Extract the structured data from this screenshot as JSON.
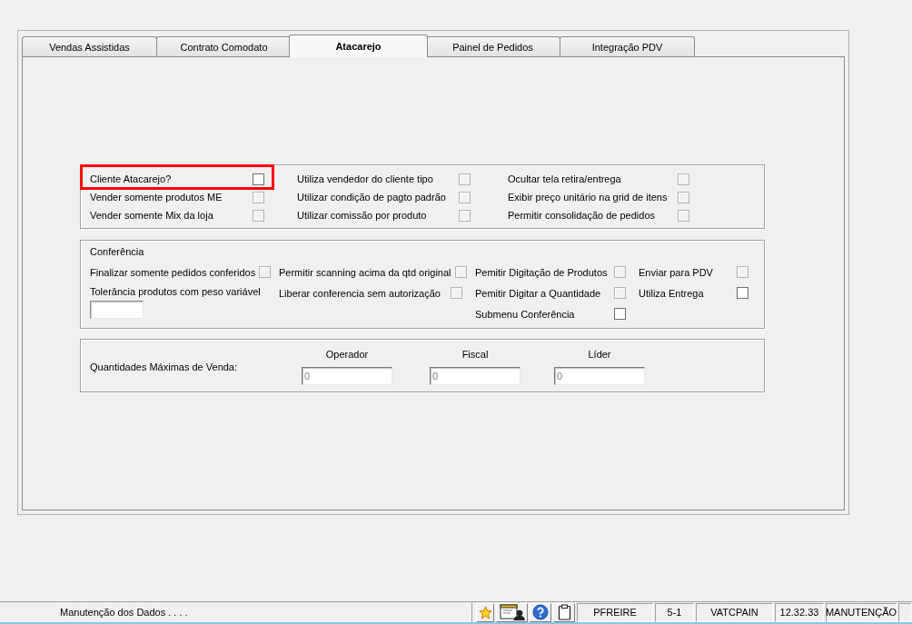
{
  "tabs": [
    {
      "label": "Vendas Assistidas",
      "selected": false
    },
    {
      "label": "Contrato Comodato",
      "selected": false
    },
    {
      "label": "Atacarejo",
      "selected": true
    },
    {
      "label": "Painel de Pedidos",
      "selected": false
    },
    {
      "label": "Integração PDV",
      "selected": false
    }
  ],
  "options": {
    "columns": [
      {
        "items": [
          {
            "label": "Cliente Atacarejo?",
            "checked": false,
            "disabled": false,
            "highlighted": true
          },
          {
            "label": "Vender somente produtos ME",
            "checked": false,
            "disabled": true,
            "highlighted": false
          },
          {
            "label": "Vender somente Mix da loja",
            "checked": false,
            "disabled": true,
            "highlighted": false
          }
        ]
      },
      {
        "items": [
          {
            "label": "Utiliza vendedor do cliente tipo",
            "checked": false,
            "disabled": true,
            "highlighted": false
          },
          {
            "label": "Utilizar condição de pagto padrão",
            "checked": false,
            "disabled": true,
            "highlighted": false
          },
          {
            "label": "Utilizar comissão por produto",
            "checked": false,
            "disabled": true,
            "highlighted": false
          }
        ]
      },
      {
        "items": [
          {
            "label": "Ocultar tela retira/entrega",
            "checked": false,
            "disabled": true,
            "highlighted": false
          },
          {
            "label": "Exibir preço unitário na grid de itens",
            "checked": false,
            "disabled": true,
            "highlighted": false
          },
          {
            "label": "Permitir consolidação de pedidos",
            "checked": false,
            "disabled": true,
            "highlighted": false
          }
        ]
      }
    ]
  },
  "conferencia": {
    "title": "Conferência",
    "columns": [
      {
        "items": [
          {
            "kind": "checkbox",
            "label": "Finalizar somente pedidos conferidos",
            "checked": false,
            "disabled": true
          },
          {
            "kind": "field",
            "label": "Tolerância produtos com peso variável"
          }
        ]
      },
      {
        "items": [
          {
            "kind": "checkbox",
            "label": "Permitir scanning acima da qtd original",
            "checked": false,
            "disabled": true
          },
          {
            "kind": "checkbox",
            "label": "Liberar conferencia sem autorização",
            "checked": false,
            "disabled": true
          }
        ]
      },
      {
        "items": [
          {
            "kind": "checkbox",
            "label": "Pemitir Digitação de Produtos",
            "checked": false,
            "disabled": true
          },
          {
            "kind": "checkbox",
            "label": "Pemitir Digitar a Quantidade",
            "checked": false,
            "disabled": true
          },
          {
            "kind": "checkbox",
            "label": "Submenu Conferência",
            "checked": false,
            "disabled": false
          }
        ]
      },
      {
        "items": [
          {
            "kind": "checkbox",
            "label": "Enviar para PDV",
            "checked": false,
            "disabled": true
          },
          {
            "kind": "checkbox",
            "label": "Utiliza Entrega",
            "checked": false,
            "disabled": false
          }
        ]
      }
    ]
  },
  "max_quantities": {
    "label": "Quantidades Máximas de Venda:",
    "fields": [
      {
        "label": "Operador",
        "value": "0",
        "disabled": true
      },
      {
        "label": "Fiscal",
        "value": "0",
        "disabled": true
      },
      {
        "label": "Líder",
        "value": "0",
        "disabled": true
      }
    ]
  },
  "status_bar": {
    "message": "Manutenção dos Dados . . . .",
    "panels": [
      "PFREIRE",
      "5-1",
      "VATCPAIN",
      "12.32.33",
      "MANUTENÇÃO"
    ]
  }
}
